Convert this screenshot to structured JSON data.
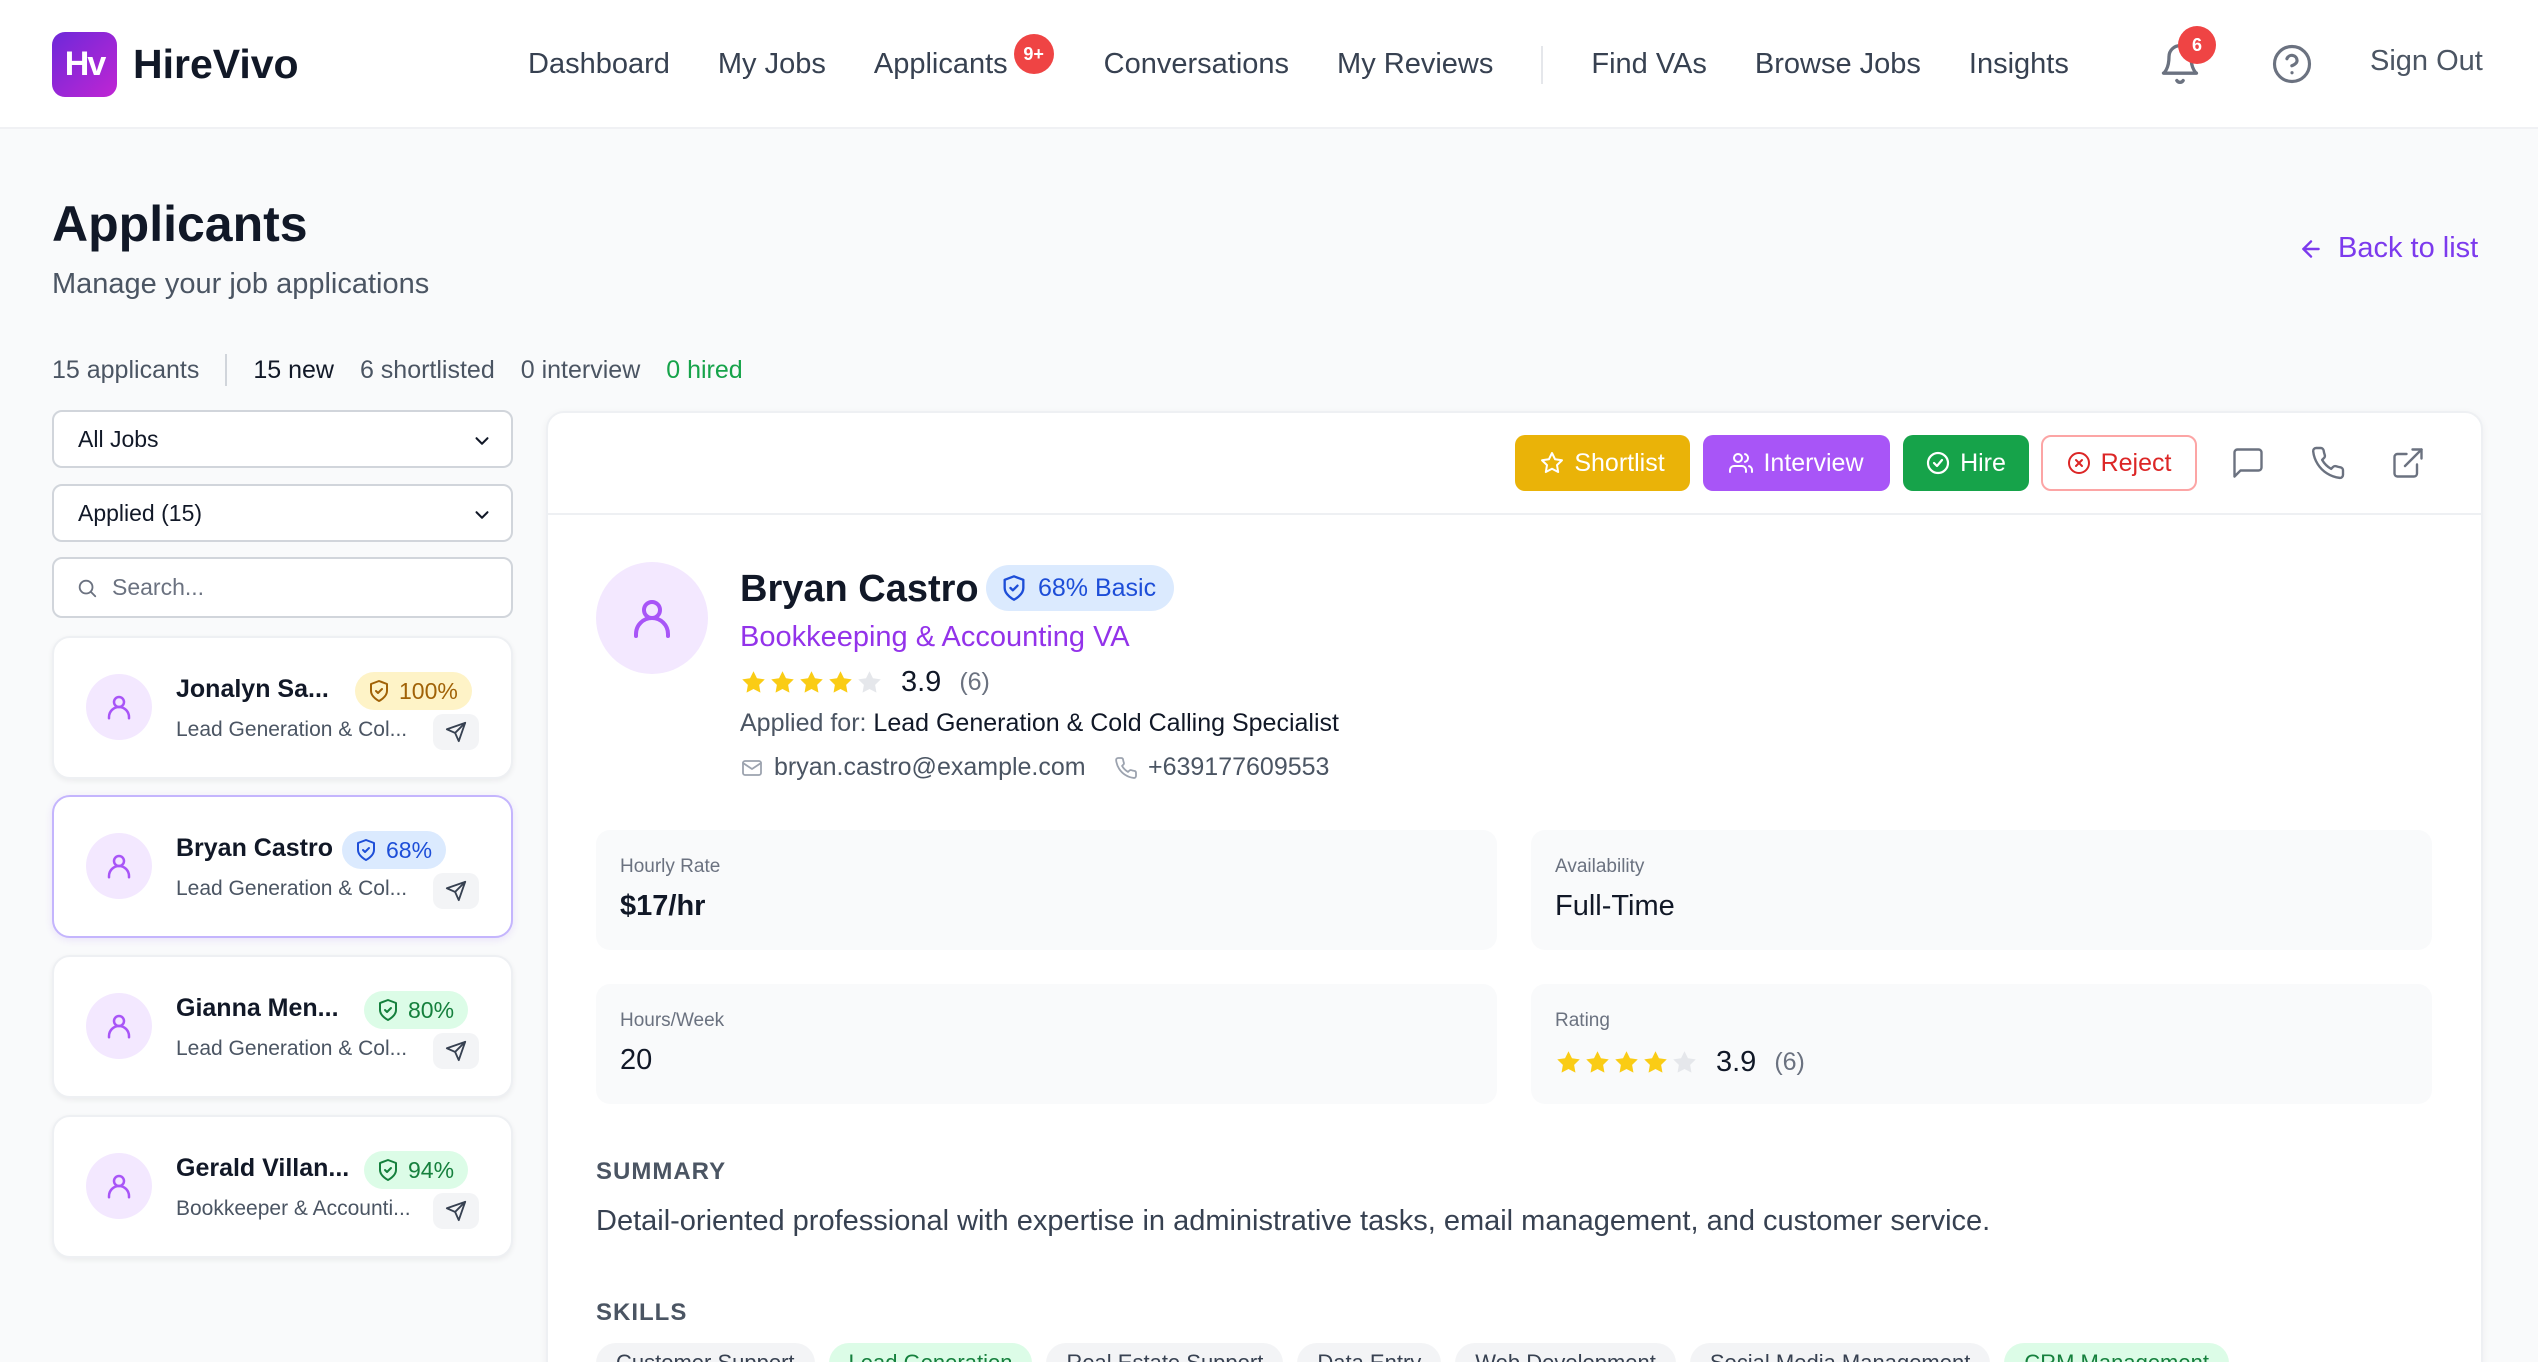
{
  "app": {
    "brand": "HireVivo",
    "logo_text": "Hv"
  },
  "nav": {
    "links": [
      "Dashboard",
      "My Jobs",
      "Applicants",
      "Conversations",
      "My Reviews",
      "Find VAs",
      "Browse Jobs",
      "Insights"
    ],
    "applicants_badge": "9+",
    "notification_count": "6",
    "sign_out": "Sign Out"
  },
  "header": {
    "title": "Applicants",
    "subtitle": "Manage your job applications",
    "back_label": "Back to list"
  },
  "stats": {
    "total": "15 applicants",
    "new": "15 new",
    "shortlisted": "6 shortlisted",
    "interview": "0 interview",
    "hired": "0 hired"
  },
  "filters": {
    "job_select": "All Jobs",
    "status_select": "Applied (15)",
    "search_placeholder": "Search..."
  },
  "applicants": [
    {
      "name": "Jonalyn Sa...",
      "role": "Lead Generation & Col...",
      "score": "100%",
      "badge_color": "#fef3c7"
    },
    {
      "name": "Bryan Castro",
      "role": "Lead Generation & Col...",
      "score": "68%",
      "badge_color": "#dbeafe"
    },
    {
      "name": "Gianna Men...",
      "role": "Lead Generation & Col...",
      "score": "80%",
      "badge_color": "#dcfce7"
    },
    {
      "name": "Gerald Villan...",
      "role": "Bookkeeper & Accounti...",
      "score": "94%",
      "badge_color": "#dcfce7"
    }
  ],
  "actions": {
    "shortlist": "Shortlist",
    "interview": "Interview",
    "hire": "Hire",
    "reject": "Reject"
  },
  "profile": {
    "name": "Bryan Castro",
    "badge": "68% Basic",
    "title": "Bookkeeping & Accounting VA",
    "rating": "3.9",
    "rating_stars": 3.9,
    "rating_count": "(6)",
    "applied_label": "Applied for:",
    "applied_job": "Lead Generation & Cold Calling Specialist",
    "email": "bryan.castro@example.com",
    "phone": "+639177609553"
  },
  "details": {
    "hourly_rate_label": "Hourly Rate",
    "hourly_rate": "$17/hr",
    "availability_label": "Availability",
    "availability": "Full-Time",
    "hours_label": "Hours/Week",
    "hours": "20",
    "rating_label": "Rating",
    "rating": "3.9",
    "rating_count": "(6)"
  },
  "summary": {
    "heading": "SUMMARY",
    "text": "Detail-oriented professional with expertise in administrative tasks, email management, and customer service."
  },
  "skills": {
    "heading": "SKILLS",
    "items": [
      "Customer Support",
      "Lead Generation",
      "Real Estate Support",
      "Data Entry",
      "Web Development",
      "Social Media Management",
      "CRM Management"
    ]
  },
  "colors": {
    "accent": "#7c3aed",
    "shortlist": "#eab308",
    "interview": "#a855f7",
    "hire": "#16a34a",
    "reject": "#dc2626"
  }
}
